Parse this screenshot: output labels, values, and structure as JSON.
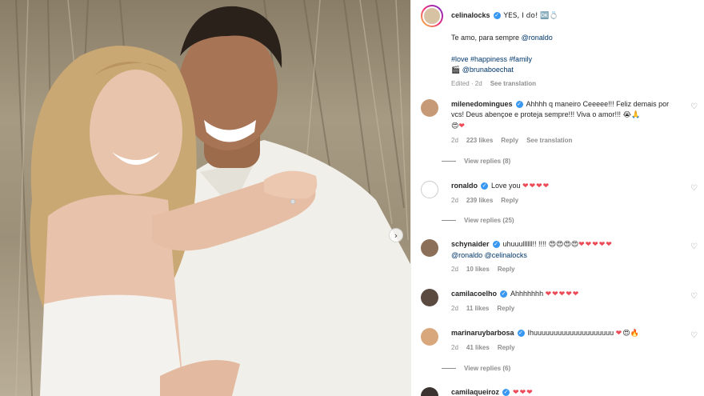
{
  "post": {
    "username": "celinalocks",
    "caption_title": "YES, I do! 🆗💍",
    "caption_line2": "Te amo, para sempre",
    "caption_mention": "@ronaldo",
    "hashtags": "#love #happiness #family",
    "credit_icon": "🎬",
    "credit_mention": "@brunaboechat",
    "edited_time": "Edited · 2d",
    "see_translation": "See translation"
  },
  "comments": [
    {
      "username": "milenedomingues",
      "verified": true,
      "text": "Ahhhh q maneiro Ceeeee!!! Feliz demais por vcs! Deus abençoe e proteja sempre!!! Viva o amor!!!",
      "emoji": "😭🙏",
      "emoji2": "😍",
      "hearts2": "❤",
      "time": "2d",
      "likes": "223 likes",
      "reply": "Reply",
      "translation": "See translation",
      "replies": "View replies (8)"
    },
    {
      "username": "ronaldo",
      "verified": true,
      "text": "Love you",
      "hearts": "❤❤❤❤",
      "time": "2d",
      "likes": "239 likes",
      "reply": "Reply",
      "replies": "View replies (25)"
    },
    {
      "username": "schynaider",
      "verified": true,
      "text": "uhuuullllll!! !!!!",
      "emoji": "😍😍😍😍",
      "hearts": "❤❤❤❤❤",
      "mentions": "@ronaldo @celinalocks",
      "time": "2d",
      "likes": "10 likes",
      "reply": "Reply"
    },
    {
      "username": "camilacoelho",
      "verified": true,
      "text": "Ahhhhhhh",
      "hearts": "❤❤❤❤❤",
      "time": "2d",
      "likes": "11 likes",
      "reply": "Reply"
    },
    {
      "username": "marinaruybarbosa",
      "verified": true,
      "text": "Ihuuuuuuuuuuuuuuuuuuuu",
      "hearts": "❤",
      "emoji": "😍🔥",
      "time": "2d",
      "likes": "41 likes",
      "reply": "Reply",
      "replies": "View replies (6)"
    },
    {
      "username": "camilaqueiroz",
      "verified": true,
      "hearts": "❤❤❤"
    }
  ],
  "icons": {
    "like": "♡",
    "verified": "✓",
    "next": "›"
  },
  "colors": {
    "verified": "#3897f0",
    "heart": "#ed4956",
    "link": "#00376b",
    "muted": "#8e8e8e"
  }
}
